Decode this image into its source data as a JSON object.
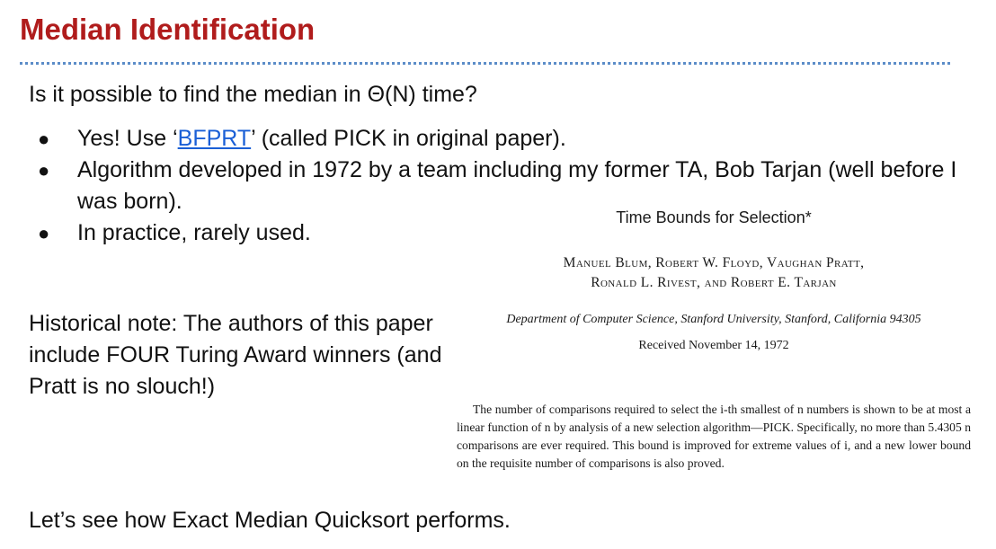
{
  "slide": {
    "title": "Median Identification",
    "question": "Is it possible to find the median in Θ(N) time?",
    "bullets": {
      "b1_prefix": "Yes! Use ‘",
      "b1_link": "BFPRT",
      "b1_suffix": "’ (called PICK in original paper).",
      "b2": "Algorithm developed in 1972 by a team including my former TA, Bob Tarjan (well before I was born).",
      "b3": "In practice, rarely used."
    },
    "bullet_glyph": "●",
    "historical_note": "Historical note: The authors of this paper include FOUR Turing Award winners (and Pratt is no slouch!)",
    "closing": "Let’s see how Exact Median Quicksort performs."
  },
  "paper": {
    "title": "Time Bounds for Selection*",
    "authors_line1": "Manuel Blum, Robert W. Floyd, Vaughan Pratt,",
    "authors_line2": "Ronald L. Rivest, and Robert E. Tarjan",
    "department": "Department of Computer Science, Stanford University, Stanford, California 94305",
    "received": "Received November 14, 1972",
    "abstract": "The number of comparisons required to select the i-th smallest of n numbers is shown to be at most a linear function of n by analysis of a new selection algorithm—PICK. Specifically, no more than 5.4305 n comparisons are ever required. This bound is improved for extreme values of i, and a new lower bound on the requisite number of comparisons is also proved."
  },
  "colors": {
    "title": "#b01c1c",
    "divider": "#5b8cc8",
    "link": "#1a5fd6"
  }
}
